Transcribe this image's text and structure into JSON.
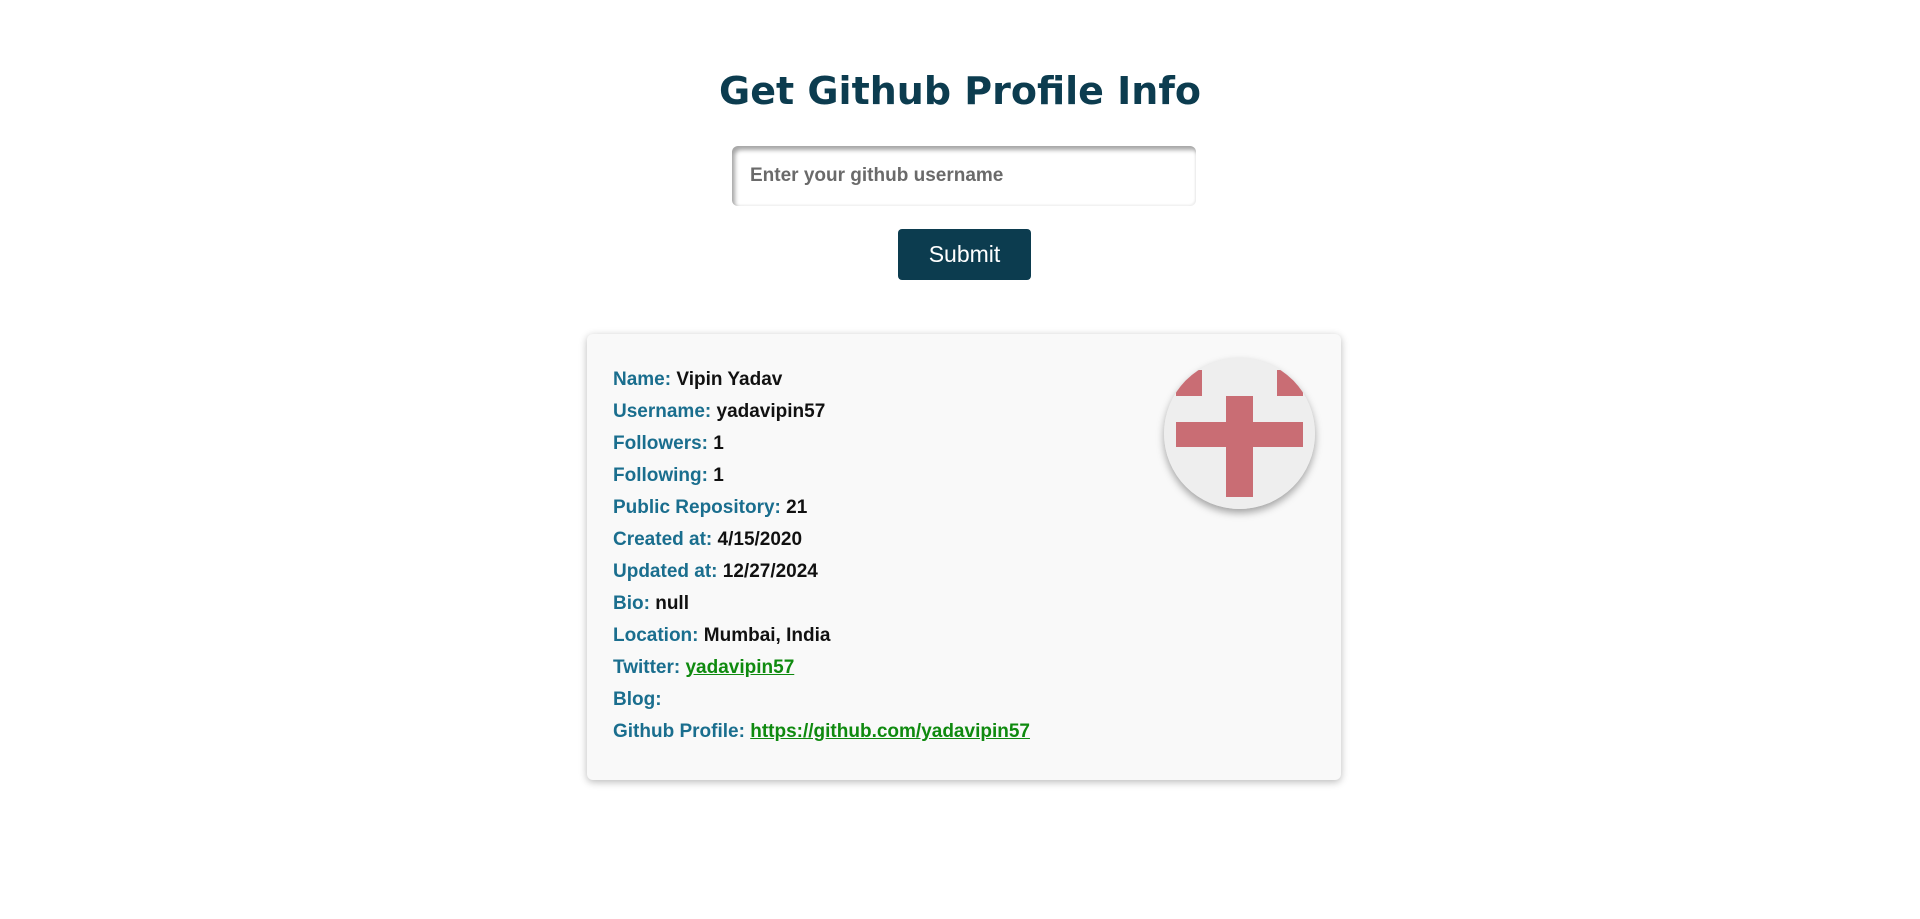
{
  "header": {
    "title": "Get Github Profile Info"
  },
  "search": {
    "placeholder": "Enter your github username",
    "value": ""
  },
  "submit": {
    "label": "Submit"
  },
  "profile": {
    "name": {
      "label": "Name:",
      "value": "Vipin Yadav"
    },
    "username": {
      "label": "Username:",
      "value": "yadavipin57"
    },
    "followers": {
      "label": "Followers:",
      "value": "1"
    },
    "following": {
      "label": "Following:",
      "value": "1"
    },
    "public_repos": {
      "label": "Public Repository:",
      "value": "21"
    },
    "created_at": {
      "label": "Created at:",
      "value": "4/15/2020"
    },
    "updated_at": {
      "label": "Updated at:",
      "value": "12/27/2024"
    },
    "bio": {
      "label": "Bio:",
      "value": "null"
    },
    "location": {
      "label": "Location:",
      "value": "Mumbai, India"
    },
    "twitter": {
      "label": "Twitter:",
      "value": "yadavipin57"
    },
    "blog": {
      "label": "Blog:",
      "value": ""
    },
    "github_profile": {
      "label": "Github Profile:",
      "value": "https://github.com/yadavipin57"
    },
    "avatar_icon": "identicon-avatar"
  },
  "colors": {
    "brand": "#0c3c4f",
    "label": "#1a6e8e",
    "link": "#0f8a0f",
    "avatar_pattern": "#c96d74",
    "card_bg": "#f9f9f9"
  }
}
